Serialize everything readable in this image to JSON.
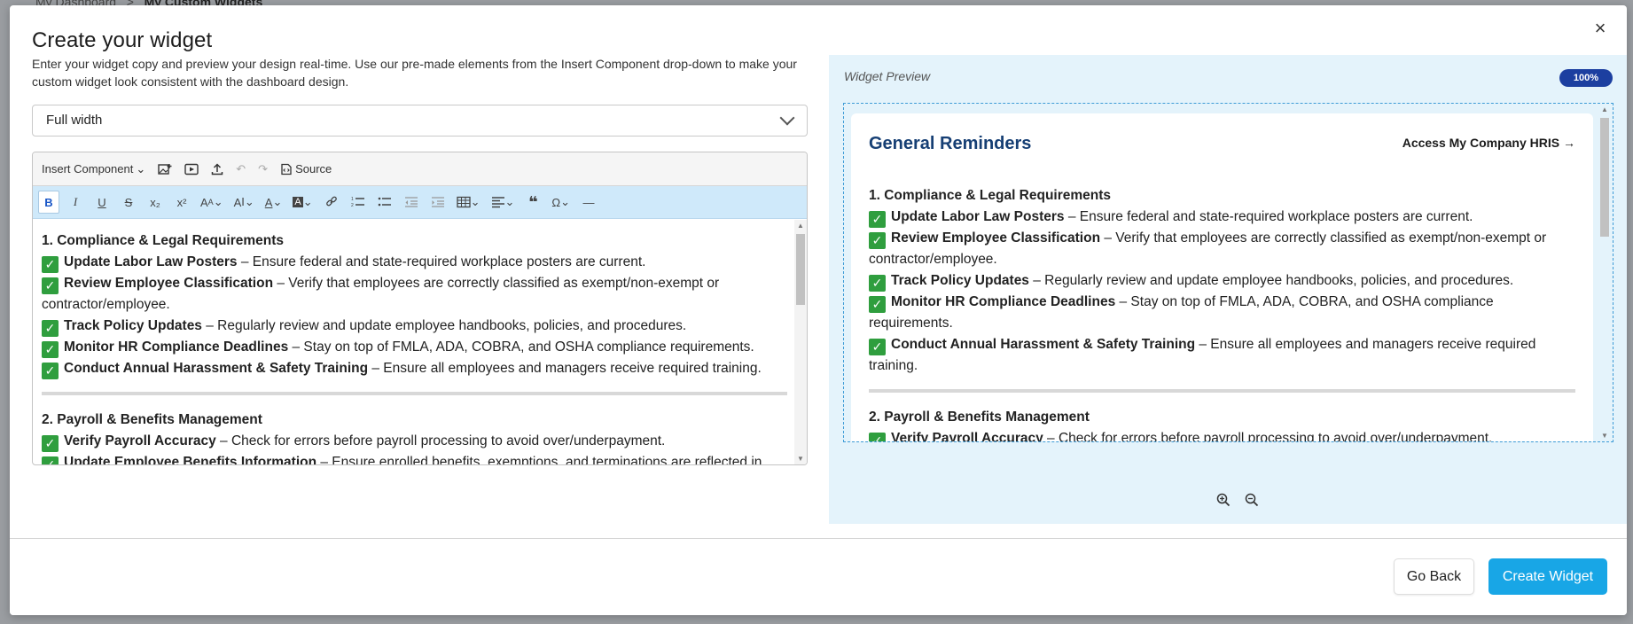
{
  "backdrop": {
    "breadcrumb_parent": "My Dashboard",
    "breadcrumb_sep": ">",
    "breadcrumb_current": "My Custom Widgets"
  },
  "modal": {
    "title": "Create your widget",
    "description": "Enter your widget copy and preview your design real-time. Use our pre-made elements from the Insert Component drop-down to make your custom widget look consistent with the dashboard design.",
    "close_label": "×",
    "width_select": {
      "value": "Full width"
    }
  },
  "toolbar1": {
    "insert_component": "Insert Component",
    "source": "Source"
  },
  "toolbar2": {
    "bold": "B",
    "italic": "I",
    "underline": "U",
    "strike": "S",
    "subscript": "x₂",
    "superscript": "x²",
    "font_size": "A",
    "font_family": "A",
    "font_color": "A",
    "bg_color": "A",
    "special_char": "Ω"
  },
  "content": {
    "section1_title": "1. Compliance & Legal Requirements",
    "section1_items": [
      {
        "bold": "Update Labor Law Posters",
        "text": " – Ensure federal and state-required workplace posters are current."
      },
      {
        "bold": "Review Employee Classification",
        "text": " – Verify that employees are correctly classified as exempt/non-exempt or contractor/employee."
      },
      {
        "bold": "Track Policy Updates",
        "text": " – Regularly review and update employee handbooks, policies, and procedures."
      },
      {
        "bold": "Monitor HR Compliance Deadlines",
        "text": " – Stay on top of FMLA, ADA, COBRA, and OSHA compliance requirements."
      },
      {
        "bold": "Conduct Annual Harassment & Safety Training",
        "text": " – Ensure all employees and managers receive required training."
      }
    ],
    "section2_title": "2. Payroll & Benefits Management",
    "section2_items": [
      {
        "bold": "Verify Payroll Accuracy",
        "text": " – Check for errors before payroll processing to avoid over/underpayment."
      },
      {
        "bold": "Update Employee Benefits Information",
        "text": " – Ensure enrolled benefits, exemptions, and terminations are reflected in"
      }
    ],
    "check": "✓"
  },
  "preview": {
    "label": "Widget Preview",
    "zoom_badge": "100%",
    "card_title": "General Reminders",
    "card_link": "Access My Company HRIS →"
  },
  "footer": {
    "go_back": "Go Back",
    "create": "Create Widget"
  }
}
